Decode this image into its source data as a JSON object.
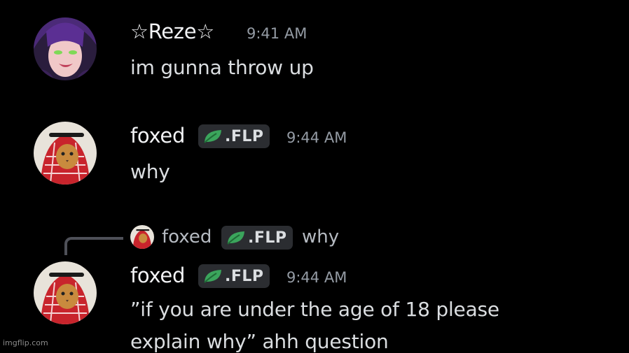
{
  "messages": [
    {
      "username": "☆Reze☆",
      "timestamp": "9:41 AM",
      "text": "im gunna throw up",
      "avatar": "anime-girl-avatar"
    },
    {
      "username": "foxed",
      "tag": ".FLP",
      "tag_icon": "leaf-icon",
      "timestamp": "9:44 AM",
      "text": "why",
      "avatar": "cat-keffiyeh-avatar"
    },
    {
      "reply": {
        "username": "foxed",
        "tag": ".FLP",
        "text": "why"
      },
      "username": "foxed",
      "tag": ".FLP",
      "timestamp": "9:44 AM",
      "line1": "”if you are under the age of 18 please",
      "line2": "explain why” ahh question",
      "avatar": "cat-keffiyeh-avatar"
    }
  ],
  "watermark": "imgflip.com",
  "colors": {
    "background": "#000000",
    "username": "#f2f3f5",
    "timestamp": "#949ba4",
    "tag_bg": "#2b2d31",
    "leaf": "#3ba55c"
  }
}
